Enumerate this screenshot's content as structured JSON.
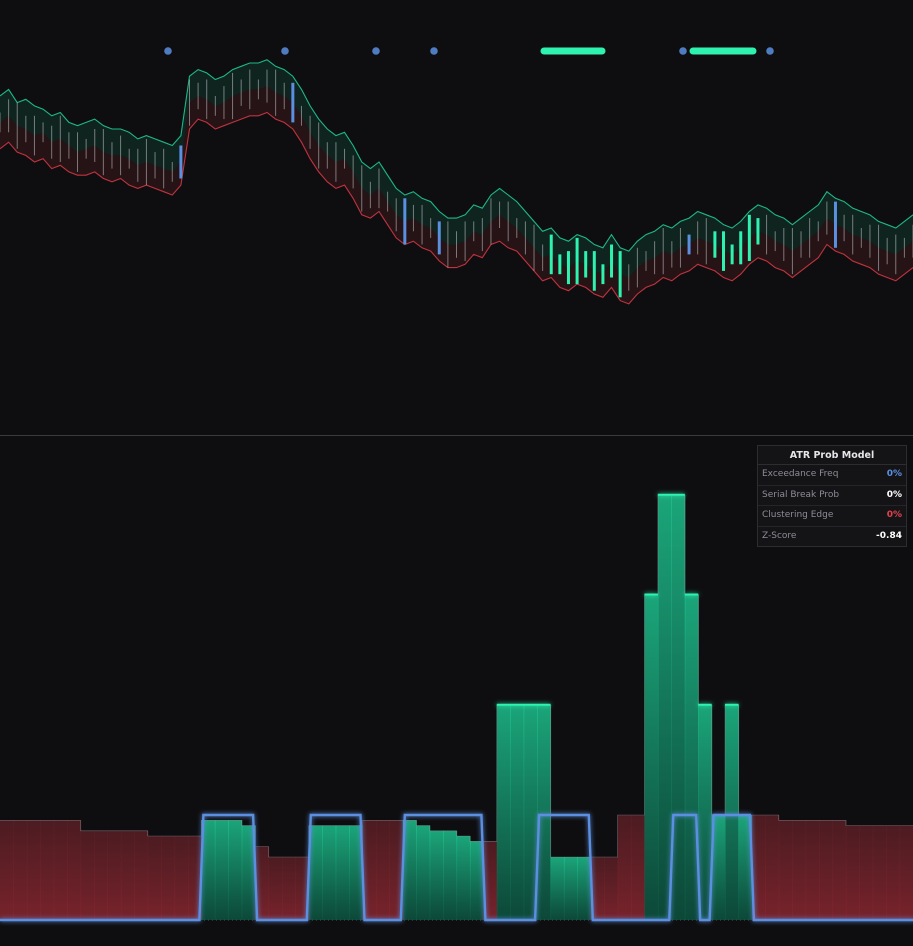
{
  "colors": {
    "background": "#0e0e10",
    "upper_band": "#1db889",
    "lower_band": "#c0333f",
    "accent_blue": "#5b8fe0",
    "highlight_green": "#2ef2b0",
    "candle_neutral": "#c9c9cf"
  },
  "stats_table": {
    "title": "ATR Prob Model",
    "rows": [
      {
        "label": "Exceedance Freq",
        "value": "0%",
        "color": "#5b8fe0"
      },
      {
        "label": "Serial Break Prob",
        "value": "0%",
        "color": "#ffffff"
      },
      {
        "label": "Clustering Edge",
        "value": "0%",
        "color": "#e0434f"
      },
      {
        "label": "Z-Score",
        "value": "-0.84",
        "color": "#ffffff"
      }
    ]
  },
  "chart_data": [
    {
      "type": "line",
      "title": "",
      "xlabel": "",
      "ylabel": "",
      "grid": false,
      "series": [
        {
          "values": [
            64,
            66,
            63,
            62,
            60,
            61,
            58,
            59,
            57,
            56,
            56,
            57,
            55,
            54,
            55,
            53,
            52,
            53,
            52,
            51,
            50,
            53,
            70,
            73,
            72,
            70,
            71,
            72,
            73,
            74,
            74,
            75,
            73,
            72,
            70,
            66,
            61,
            57,
            54,
            52,
            53,
            49,
            44,
            43,
            45,
            41,
            37,
            35,
            36,
            34,
            33,
            30,
            28,
            28,
            29,
            32,
            31,
            35,
            36,
            34,
            33,
            30,
            27,
            24,
            25,
            22,
            21,
            23,
            22,
            20,
            19,
            22,
            18,
            17,
            20,
            22,
            23,
            25,
            24,
            26,
            27,
            29,
            28,
            27,
            25,
            24,
            26,
            29,
            31,
            30,
            28,
            27,
            25,
            27,
            29,
            31,
            35,
            33,
            32,
            30,
            29,
            28,
            26,
            25,
            24,
            26,
            28
          ]
        },
        {
          "values": [
            80,
            82,
            78,
            79,
            77,
            76,
            74,
            75,
            72,
            71,
            72,
            73,
            71,
            70,
            70,
            69,
            67,
            68,
            67,
            66,
            65,
            68,
            86,
            88,
            87,
            85,
            86,
            88,
            89,
            90,
            90,
            91,
            89,
            88,
            86,
            82,
            77,
            73,
            70,
            68,
            69,
            65,
            60,
            58,
            60,
            56,
            52,
            50,
            51,
            49,
            48,
            45,
            43,
            43,
            44,
            47,
            46,
            50,
            52,
            50,
            48,
            45,
            42,
            39,
            40,
            37,
            36,
            38,
            37,
            35,
            34,
            38,
            34,
            33,
            36,
            38,
            39,
            41,
            40,
            42,
            43,
            45,
            44,
            43,
            41,
            40,
            42,
            45,
            47,
            46,
            44,
            43,
            41,
            43,
            45,
            47,
            51,
            49,
            48,
            46,
            45,
            44,
            42,
            41,
            40,
            42,
            44
          ]
        },
        {
          "values": [
            72,
            74,
            71,
            70,
            68,
            69,
            66,
            67,
            65,
            63,
            64,
            65,
            63,
            62,
            62,
            61,
            59,
            60,
            59,
            58,
            57,
            60,
            78,
            80,
            79,
            77,
            78,
            80,
            81,
            82,
            82,
            83,
            81,
            80,
            78,
            74,
            69,
            65,
            62,
            60,
            61,
            57,
            52,
            50,
            52,
            48,
            44,
            42,
            43,
            41,
            40,
            37,
            35,
            35,
            36,
            39,
            38,
            42,
            44,
            42,
            40,
            37,
            34,
            31,
            32,
            29,
            28,
            30,
            29,
            27,
            26,
            30,
            26,
            25,
            28,
            30,
            31,
            33,
            32,
            34,
            35,
            37,
            36,
            35,
            33,
            32,
            34,
            37,
            39,
            38,
            36,
            35,
            33,
            35,
            37,
            39,
            43,
            41,
            40,
            38,
            37,
            36,
            34,
            33,
            32,
            34,
            36
          ]
        }
      ]
    },
    {
      "type": "area",
      "title": "",
      "xlabel": "",
      "ylabel": "",
      "grid": false,
      "series": [
        {
          "values": [
            0.95,
            0.95,
            0.95,
            0.95,
            0.95,
            0.95,
            0.85,
            0.85,
            0.85,
            0.85,
            0.85,
            0.8,
            0.8,
            0.8,
            0.8,
            0.95,
            0.95,
            0.95,
            0.9,
            0.7,
            0.6,
            0.6,
            0.6,
            0.9,
            0.9,
            0.9,
            0.9,
            0.95,
            0.95,
            0.95,
            0.95,
            0.9,
            0.85,
            0.85,
            0.8,
            0.75,
            0.75,
            2.05,
            2.05,
            2.05,
            2.05,
            0.6,
            0.6,
            0.6,
            0.6,
            0.6,
            1.0,
            1.0,
            3.1,
            4.05,
            4.05,
            3.1,
            2.05,
            1.0,
            2.05,
            1.0,
            1.0,
            1.0,
            0.95,
            0.95,
            0.95,
            0.95,
            0.95,
            0.9,
            0.9,
            0.9,
            0.9,
            0.9,
            0.9
          ]
        },
        {
          "values": [
            0,
            0,
            0,
            0,
            0,
            0,
            0,
            0,
            0,
            0,
            0,
            0,
            0,
            0,
            0,
            1,
            1,
            1,
            1,
            0,
            0,
            0,
            0,
            1,
            1,
            1,
            1,
            0,
            0,
            0,
            1,
            1,
            1,
            1,
            1,
            1,
            0,
            0,
            0,
            0,
            1,
            1,
            1,
            1,
            0,
            0,
            0,
            0,
            0,
            0,
            1,
            1,
            0,
            1,
            1,
            1,
            0,
            0,
            0,
            0,
            0,
            0,
            0,
            0,
            0,
            0,
            0,
            0,
            0
          ]
        }
      ]
    }
  ]
}
